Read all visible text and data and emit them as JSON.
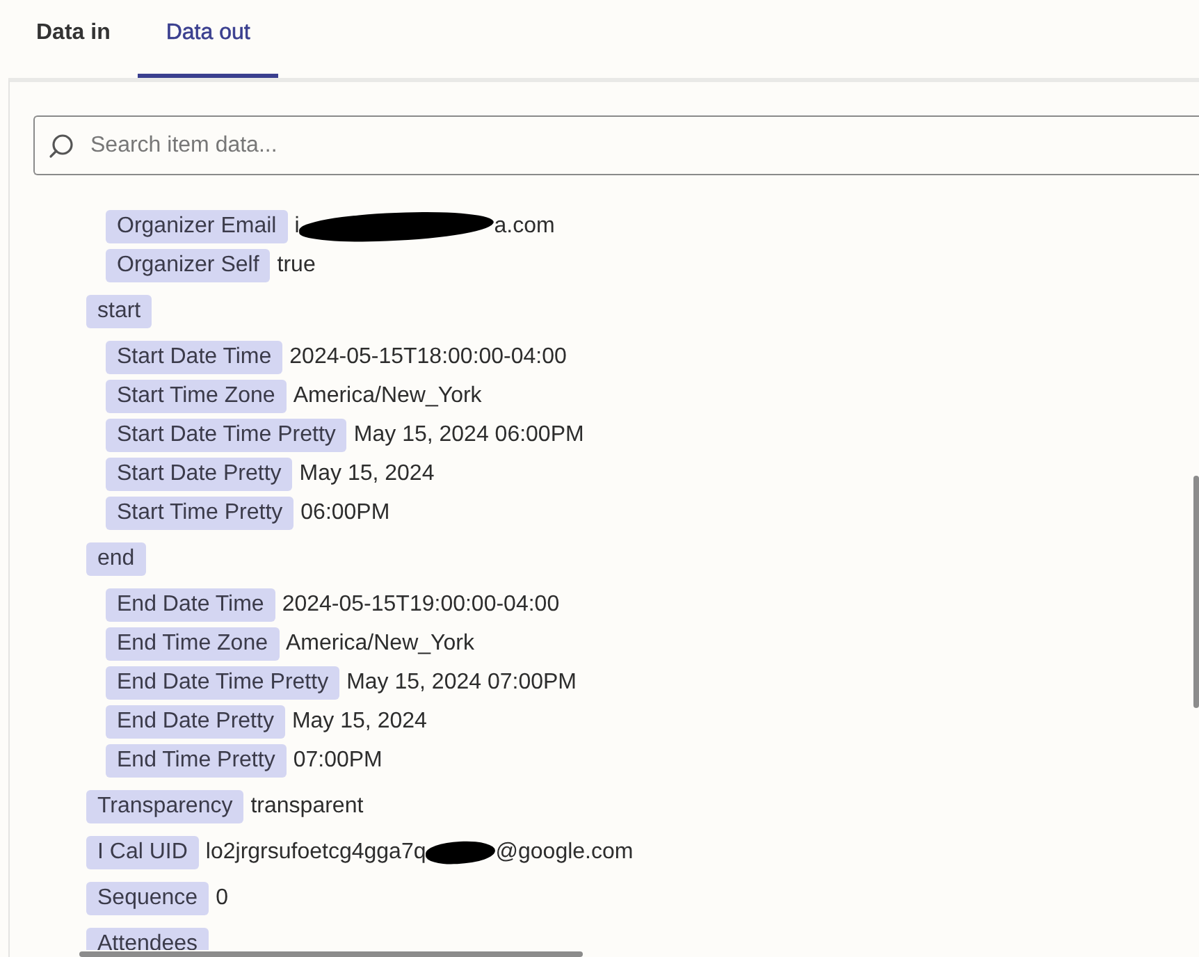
{
  "tabs": [
    {
      "label": "Data in",
      "selected": false
    },
    {
      "label": "Data out",
      "selected": true
    }
  ],
  "search": {
    "placeholder": "Search item data..."
  },
  "items": [
    {
      "children": [
        {
          "label": "Organizer Email",
          "value": "i",
          "redacted": true,
          "value_after": "a.com"
        },
        {
          "label": "Organizer Self",
          "value": "true"
        }
      ]
    },
    {
      "label": "start",
      "children": [
        {
          "label": "Start Date Time",
          "value": "2024-05-15T18:00:00-04:00"
        },
        {
          "label": "Start Time Zone",
          "value": "America/New_York"
        },
        {
          "label": "Start Date Time Pretty",
          "value": "May 15, 2024 06:00PM"
        },
        {
          "label": "Start Date Pretty",
          "value": "May 15, 2024"
        },
        {
          "label": "Start Time Pretty",
          "value": "06:00PM"
        }
      ]
    },
    {
      "label": "end",
      "children": [
        {
          "label": "End Date Time",
          "value": "2024-05-15T19:00:00-04:00"
        },
        {
          "label": "End Time Zone",
          "value": "America/New_York"
        },
        {
          "label": "End Date Time Pretty",
          "value": "May 15, 2024 07:00PM"
        },
        {
          "label": "End Date Pretty",
          "value": "May 15, 2024"
        },
        {
          "label": "End Time Pretty",
          "value": "07:00PM"
        }
      ]
    },
    {
      "label": "Transparency",
      "value": "transparent"
    },
    {
      "label": "I Cal UID",
      "value": "lo2jrgrsufoetcg4gga7q",
      "redacted": true,
      "value_after": "@google.com"
    },
    {
      "label": "Sequence",
      "value": "0"
    },
    {
      "label": "Attendees"
    }
  ]
}
